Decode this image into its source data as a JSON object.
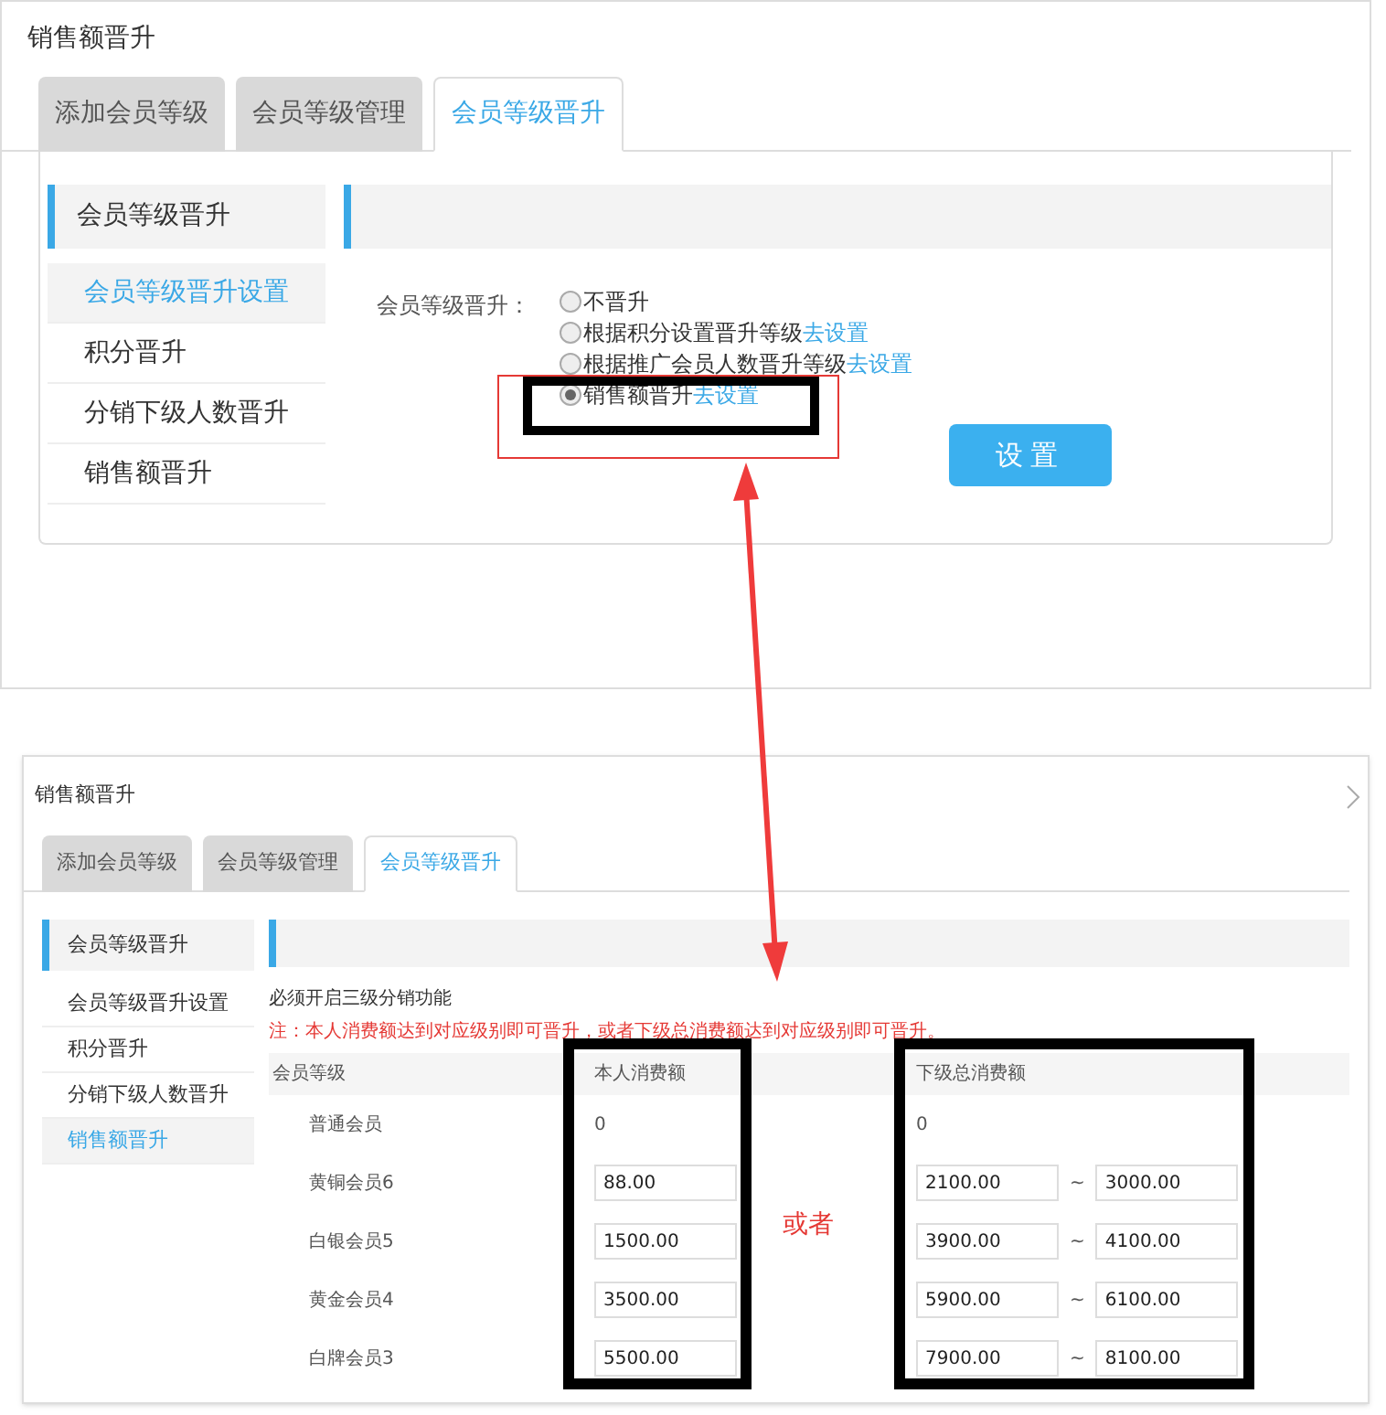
{
  "panels": [
    {
      "title": "销售额晋升",
      "tabs": [
        {
          "label": "添加会员等级",
          "selected": false
        },
        {
          "label": "会员等级管理",
          "selected": false
        },
        {
          "label": "会员等级晋升",
          "selected": true
        }
      ],
      "sidebar": {
        "header": "会员等级晋升",
        "items": [
          {
            "label": "会员等级晋升设置",
            "selected": true
          },
          {
            "label": "积分晋升",
            "selected": false
          },
          {
            "label": "分销下级人数晋升",
            "selected": false
          },
          {
            "label": "销售额晋升",
            "selected": false
          }
        ]
      },
      "kind": "radio_form",
      "form": {
        "label": "会员等级晋升：",
        "options": [
          {
            "label": "不晋升",
            "selected": false
          },
          {
            "label": "根据积分设置晋升等级",
            "link": "去设置",
            "selected": false
          },
          {
            "label": "根据推广会员人数晋升等级",
            "link": "去设置",
            "selected": false
          },
          {
            "label": "销售额晋升",
            "link": "去设置",
            "selected": true
          }
        ],
        "button": "设置"
      }
    },
    {
      "title": "销售额晋升",
      "tabs": [
        {
          "label": "添加会员等级",
          "selected": false
        },
        {
          "label": "会员等级管理",
          "selected": false
        },
        {
          "label": "会员等级晋升",
          "selected": true
        }
      ],
      "sidebar": {
        "header": "会员等级晋升",
        "items": [
          {
            "label": "会员等级晋升设置",
            "selected": false
          },
          {
            "label": "积分晋升",
            "selected": false
          },
          {
            "label": "分销下级人数晋升",
            "selected": false
          },
          {
            "label": "销售额晋升",
            "selected": true
          }
        ]
      },
      "kind": "table_form",
      "notice": "必须开启三级分销功能",
      "note": "注：本人消费额达到对应级别即可晋升，或者下级总消费额达到对应级别即可晋升。",
      "table": {
        "columns": [
          "会员等级",
          "本人消费额",
          "下级总消费额"
        ],
        "separator": "~",
        "or_label": "或者",
        "rows": [
          {
            "level": "普通会员",
            "own": "0",
            "team_min": "0"
          },
          {
            "level": "黄铜会员6",
            "own": "88.00",
            "team_min": "2100.00",
            "team_max": "3000.00"
          },
          {
            "level": "白银会员5",
            "own": "1500.00",
            "team_min": "3900.00",
            "team_max": "4100.00"
          },
          {
            "level": "黄金会员4",
            "own": "3500.00",
            "team_min": "5900.00",
            "team_max": "6100.00"
          },
          {
            "level": "白牌会员3",
            "own": "5500.00",
            "team_min": "7900.00",
            "team_max": "8100.00"
          }
        ]
      }
    }
  ]
}
